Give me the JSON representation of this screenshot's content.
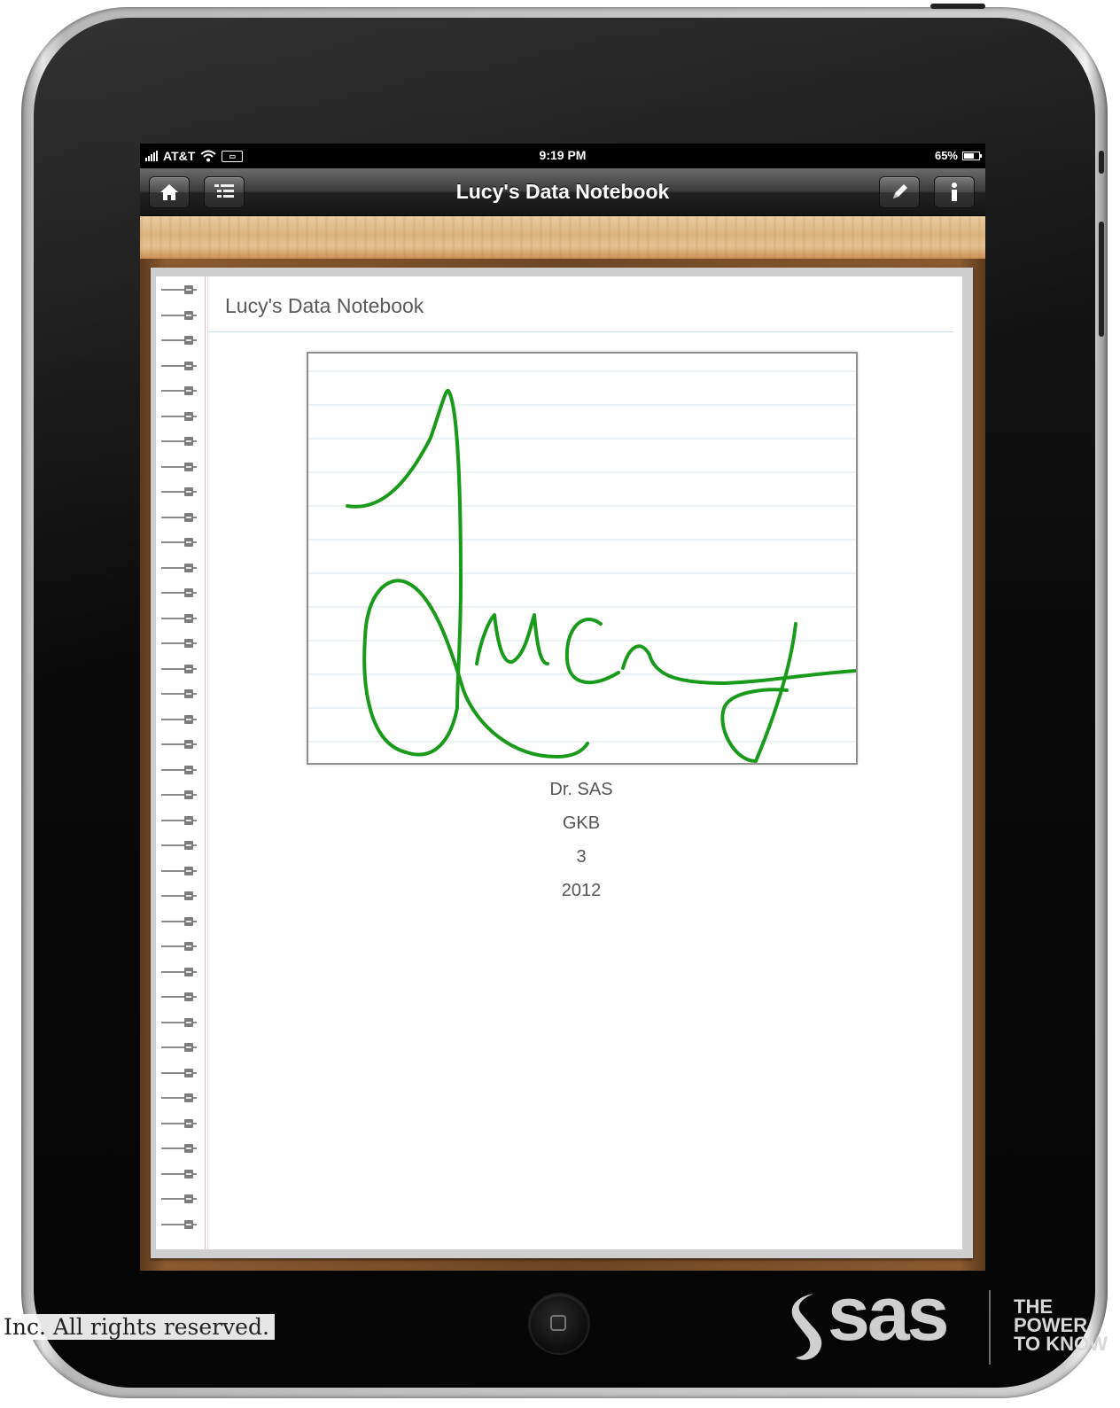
{
  "status_bar": {
    "carrier": "AT&T",
    "time": "9:19 PM",
    "battery": "65%"
  },
  "nav": {
    "title": "Lucy's Data Notebook",
    "left_buttons": [
      "home-icon",
      "list-icon"
    ],
    "right_buttons": [
      "pencil-icon",
      "info-icon"
    ]
  },
  "notebook": {
    "page_title": "Lucy's Data Notebook",
    "signature": "Lucy",
    "signature_color": "#1a9a1a",
    "details": [
      "Dr. SAS",
      "GKB",
      "3",
      "2012"
    ]
  },
  "footer": {
    "rights_text": "Inc. All rights reserved.",
    "logo": "sas",
    "tagline": [
      "THE",
      "POWER",
      "TO KNOW"
    ]
  }
}
